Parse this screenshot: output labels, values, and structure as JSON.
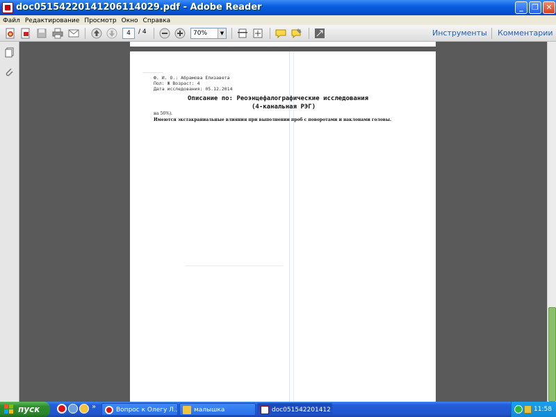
{
  "window": {
    "title": "doc05154220141206114029.pdf - Adobe Reader",
    "minimize": "_",
    "maximize": "❐",
    "close": "✕"
  },
  "menu": [
    "Файл",
    "Редактирование",
    "Просмотр",
    "Окно",
    "Справка"
  ],
  "toolbar": {
    "page_current": "4",
    "page_total": "/ 4",
    "zoom": "70%",
    "tools_label": "Инструменты",
    "comments_label": "Комментарии"
  },
  "document": {
    "fio": "Ф. И. О.: Абрамова Елизавета",
    "sex_age": "Пол: Ж   Возраст: 4",
    "date": "Дата исследования: 05.12.2014",
    "heading1": "Описание по: Реоэнцефалографические исследования",
    "heading2": "(4-канальная РЭГ)",
    "line1": "на 56%).",
    "line2": "Имеются экстакраниальные влияния при выполнении проб с поворотами и наклонами головы."
  },
  "taskbar": {
    "start": "пуск",
    "chevron": "»",
    "tasks": [
      {
        "label": "Вопрос к Олегу Л..."
      },
      {
        "label": "малышка"
      },
      {
        "label": "doc051542201412..."
      }
    ],
    "clock": "11:58"
  },
  "colors": {
    "accent": "#0a5fe0",
    "link": "#2060c0",
    "scroll_thumb": "#8dc06a"
  }
}
